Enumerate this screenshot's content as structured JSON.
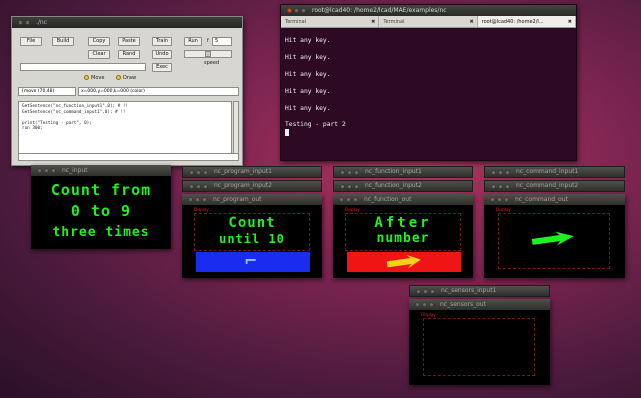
{
  "control_panel": {
    "title": "./nc",
    "buttons": {
      "file": "File",
      "build": "Build",
      "copy": "Copy",
      "paste": "Paste",
      "train": "Train",
      "run": "Run",
      "clear": "Clear",
      "rand": "Rand",
      "undo": "Undo",
      "exec": "Exec"
    },
    "speed_value": "5",
    "speed_label": "speed",
    "mode_options": [
      "Move",
      "Draw"
    ],
    "status": "{move (70,48)",
    "coords": "x=000,y=000,k=000 (color)",
    "code_lines": [
      "GetSentence(\"nc_function_input1\",0);          # !!",
      "GetSentence(\"nc_command_input1\",0);           # !!",
      "",
      "print(\"Testing - part\", 0);",
      "run 300;"
    ]
  },
  "terminal": {
    "title": "root@lcad40: /home2/lcad/MAE/examples/nc",
    "tabs": [
      {
        "label": "Terminal",
        "active": false
      },
      {
        "label": "Terminal",
        "active": false
      },
      {
        "label": "root@lcad40: /home2/l...",
        "active": true
      }
    ],
    "lines": [
      "Hit any key.",
      "Hit any key.",
      "Hit any key.",
      "Hit any key.",
      "Hit any key.",
      "Testing - part 2"
    ]
  },
  "nc_input": {
    "title": "nc_input",
    "lines": [
      "Count from",
      "0 to 9",
      "three times"
    ]
  },
  "program": {
    "bar1": "nc_program_input1",
    "bar2": "nc_program_input2",
    "title": "nc_program_out",
    "display_label": "Display",
    "lines": [
      "Count",
      "until 10"
    ],
    "arrow": "⌐"
  },
  "function": {
    "bar1": "nc_function_input1",
    "bar2": "nc_function_input2",
    "title": "nc_function_out",
    "display_label": "Display",
    "lines": [
      "After",
      "number"
    ]
  },
  "command": {
    "bar1": "nc_command_input1",
    "bar2": "nc_command_input2",
    "title": "nc_command_out",
    "display_label": "Display"
  },
  "sensors": {
    "bar1": "nc_sensors_input1",
    "title": "nc_sensors_out",
    "display_label": "Display"
  },
  "colors": {
    "green_text": "#1ff01f",
    "blue_bar": "#1a2cf0",
    "red_bar": "#f01414",
    "arrow_yellow": "#f3d21a",
    "terminal_bg": "#2d0923"
  }
}
